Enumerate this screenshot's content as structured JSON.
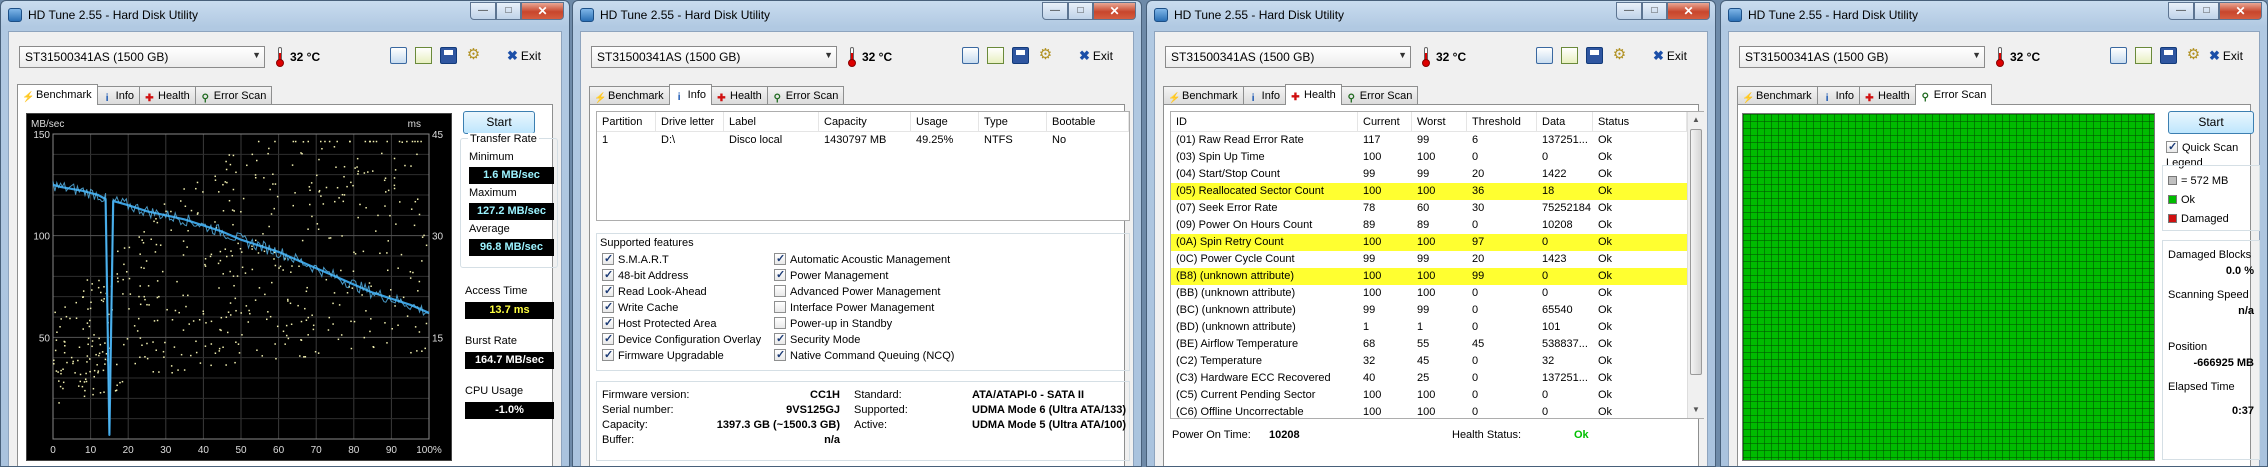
{
  "app": {
    "title": "HD Tune 2.55 - Hard Disk Utility",
    "drive": "ST31500341AS (1500 GB)",
    "temperature": "32 °C",
    "exit": "Exit",
    "tabs": {
      "benchmark": "Benchmark",
      "info": "Info",
      "health": "Health",
      "error_scan": "Error Scan"
    }
  },
  "benchmark": {
    "start": "Start",
    "transfer_rate": "Transfer Rate",
    "minimum_label": "Minimum",
    "minimum": "1.6 MB/sec",
    "maximum_label": "Maximum",
    "maximum": "127.2 MB/sec",
    "average_label": "Average",
    "average": "96.8 MB/sec",
    "access_label": "Access Time",
    "access": "13.7 ms",
    "burst_label": "Burst Rate",
    "burst": "164.7 MB/sec",
    "cpu_label": "CPU Usage",
    "cpu": "-1.0%"
  },
  "chart_data": {
    "type": "line",
    "ylabel": "MB/sec",
    "y2label": "ms",
    "ylim": [
      0,
      150
    ],
    "y2lim": [
      0,
      45
    ],
    "y_ticks": [
      "150",
      "100",
      "50"
    ],
    "y2_ticks": [
      "45",
      "30",
      "15"
    ],
    "x_ticks": [
      "0",
      "10",
      "20",
      "30",
      "40",
      "50",
      "60",
      "70",
      "80",
      "90",
      "100%"
    ],
    "grid": true,
    "series": [
      {
        "x": [
          0,
          2,
          5,
          8,
          10,
          12,
          14,
          15,
          16,
          18,
          20,
          25,
          30,
          35,
          40,
          45,
          50,
          55,
          60,
          65,
          70,
          75,
          80,
          85,
          90,
          95,
          100
        ],
        "values": [
          125,
          124,
          123,
          122,
          121,
          120,
          118,
          2,
          117,
          116,
          115,
          112,
          110,
          108,
          105,
          102,
          98,
          95,
          92,
          88,
          84,
          80,
          76,
          72,
          69,
          66,
          62
        ]
      },
      {
        "x": [
          0,
          10,
          20,
          30,
          40,
          50,
          60,
          70,
          80,
          90,
          100
        ],
        "values": [
          14,
          18,
          22,
          26,
          30,
          32,
          34,
          35,
          36,
          36,
          37
        ]
      }
    ]
  },
  "info": {
    "columns": [
      "Partition",
      "Drive letter",
      "Label",
      "Capacity",
      "Usage",
      "Type",
      "Bootable"
    ],
    "rows": [
      [
        "1",
        "D:\\",
        "Disco local",
        "1430797 MB",
        "49.25%",
        "NTFS",
        "No"
      ]
    ],
    "features_title": "Supported features",
    "features_left": [
      {
        "label": "S.M.A.R.T",
        "on": true
      },
      {
        "label": "48-bit Address",
        "on": true
      },
      {
        "label": "Read Look-Ahead",
        "on": true
      },
      {
        "label": "Write Cache",
        "on": true
      },
      {
        "label": "Host Protected Area",
        "on": true
      },
      {
        "label": "Device Configuration Overlay",
        "on": true
      },
      {
        "label": "Firmware Upgradable",
        "on": true
      }
    ],
    "features_right": [
      {
        "label": "Automatic Acoustic Management",
        "on": true
      },
      {
        "label": "Power Management",
        "on": true
      },
      {
        "label": "Advanced Power Management",
        "on": false
      },
      {
        "label": "Interface Power Management",
        "on": false
      },
      {
        "label": "Power-up in Standby",
        "on": false
      },
      {
        "label": "Security Mode",
        "on": true
      },
      {
        "label": "Native Command Queuing (NCQ)",
        "on": true
      }
    ],
    "fw_label": "Firmware version:",
    "fw": "CC1H",
    "sn_label": "Serial number:",
    "sn": "9VS125GJ",
    "cap_label": "Capacity:",
    "cap": "1397.3 GB (~1500.3 GB)",
    "buf_label": "Buffer:",
    "buf": "n/a",
    "std_label": "Standard:",
    "std": "ATA/ATAPI-0 - SATA II",
    "sup_label": "Supported:",
    "sup": "UDMA Mode 6 (Ultra ATA/133)",
    "act_label": "Active:",
    "act": "UDMA Mode 5 (Ultra ATA/100)"
  },
  "health": {
    "columns": [
      "ID",
      "Current",
      "Worst",
      "Threshold",
      "Data",
      "Status"
    ],
    "rows": [
      [
        "(01) Raw Read Error Rate",
        "117",
        "99",
        "6",
        "137251...",
        "Ok"
      ],
      [
        "(03) Spin Up Time",
        "100",
        "100",
        "0",
        "0",
        "Ok"
      ],
      [
        "(04) Start/Stop Count",
        "99",
        "99",
        "20",
        "1422",
        "Ok"
      ],
      [
        "(05) Reallocated Sector Count",
        "100",
        "100",
        "36",
        "18",
        "Ok"
      ],
      [
        "(07) Seek Error Rate",
        "78",
        "60",
        "30",
        "75252184",
        "Ok"
      ],
      [
        "(09) Power On Hours Count",
        "89",
        "89",
        "0",
        "10208",
        "Ok"
      ],
      [
        "(0A) Spin Retry Count",
        "100",
        "100",
        "97",
        "0",
        "Ok"
      ],
      [
        "(0C) Power Cycle Count",
        "99",
        "99",
        "20",
        "1423",
        "Ok"
      ],
      [
        "(B8) (unknown attribute)",
        "100",
        "100",
        "99",
        "0",
        "Ok"
      ],
      [
        "(BB) (unknown attribute)",
        "100",
        "100",
        "0",
        "0",
        "Ok"
      ],
      [
        "(BC) (unknown attribute)",
        "99",
        "99",
        "0",
        "65540",
        "Ok"
      ],
      [
        "(BD) (unknown attribute)",
        "1",
        "1",
        "0",
        "101",
        "Ok"
      ],
      [
        "(BE) Airflow Temperature",
        "68",
        "55",
        "45",
        "538837...",
        "Ok"
      ],
      [
        "(C2) Temperature",
        "32",
        "45",
        "0",
        "32",
        "Ok"
      ],
      [
        "(C3) Hardware ECC Recovered",
        "40",
        "25",
        "0",
        "137251...",
        "Ok"
      ],
      [
        "(C5) Current Pending Sector",
        "100",
        "100",
        "0",
        "0",
        "Ok"
      ],
      [
        "(C6) Offline Uncorrectable",
        "100",
        "100",
        "0",
        "0",
        "Ok"
      ]
    ],
    "highlighted": [
      3,
      6,
      8
    ],
    "highlight_color": "#ffff30",
    "pot_label": "Power On Time:",
    "pot": "10208",
    "hs_label": "Health Status:",
    "hs": "Ok",
    "ok_color": "#00c000"
  },
  "error_scan": {
    "start": "Start",
    "quick": "Quick Scan",
    "legend": "Legend",
    "legend_items": [
      {
        "label": "= 572 MB",
        "color": "#c0c0c0"
      },
      {
        "label": "Ok",
        "color": "#00bb00"
      },
      {
        "label": "Damaged",
        "color": "#d01010"
      }
    ],
    "damaged_label": "Damaged Blocks",
    "damaged": "0.0 %",
    "speed_label": "Scanning Speed",
    "speed": "n/a",
    "pos_label": "Position",
    "pos": "-666925 MB",
    "elapsed_label": "Elapsed Time",
    "elapsed": "0:37"
  }
}
